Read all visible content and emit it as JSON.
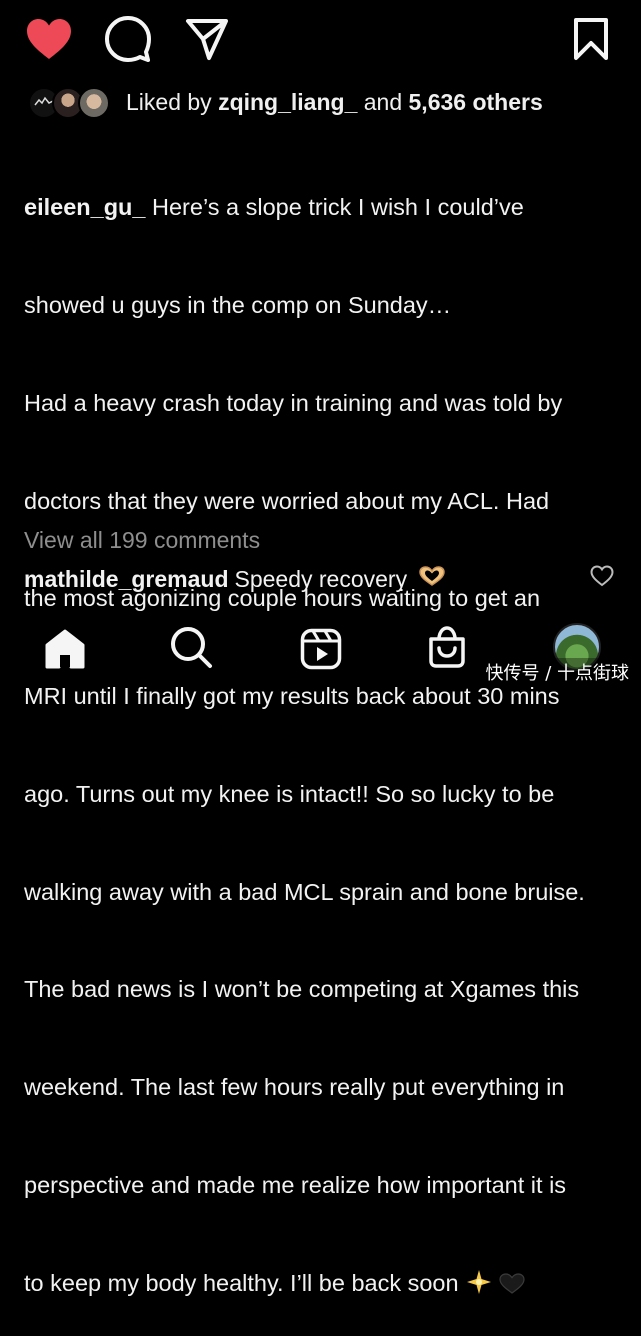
{
  "actions": {
    "like_color": "#ed4956",
    "icons": [
      "heart-filled-icon",
      "comment-icon",
      "share-icon",
      "bookmark-icon"
    ]
  },
  "likes": {
    "prefix": "Liked by ",
    "user": "zqing_liang_",
    "middle": " and ",
    "others": "5,636 others"
  },
  "caption": {
    "user": "eileen_gu_",
    "lines": [
      " Here’s a slope trick I wish I could’ve",
      "showed u guys in the comp on Sunday…",
      "Had a heavy crash today in training and was told by",
      "doctors that they were worried about my ACL. Had",
      "the most agonizing couple hours waiting to get an",
      "MRI until I finally got my results back about 30 mins",
      "ago. Turns out my knee is intact!! So so lucky to be",
      "walking away with a bad MCL sprain and bone bruise.",
      "The bad news is I won’t be competing at Xgames this",
      "weekend. The last few hours really put everything in",
      "perspective and made me realize how important it is",
      "to keep my body healthy. I’ll be back soon"
    ],
    "emoji_icons": [
      "sparkle-emoji-icon",
      "black-heart-emoji-icon"
    ]
  },
  "comments": {
    "view_all": "View all 199 comments",
    "top": {
      "user": "mathilde_gremaud",
      "text": "Speedy recovery",
      "emoji_icon": "heart-hands-emoji-icon"
    }
  },
  "nav": {
    "icons": [
      "home-icon",
      "search-icon",
      "reels-icon",
      "shop-icon",
      "profile-avatar"
    ]
  },
  "watermark": "快传号 / 十点街球"
}
